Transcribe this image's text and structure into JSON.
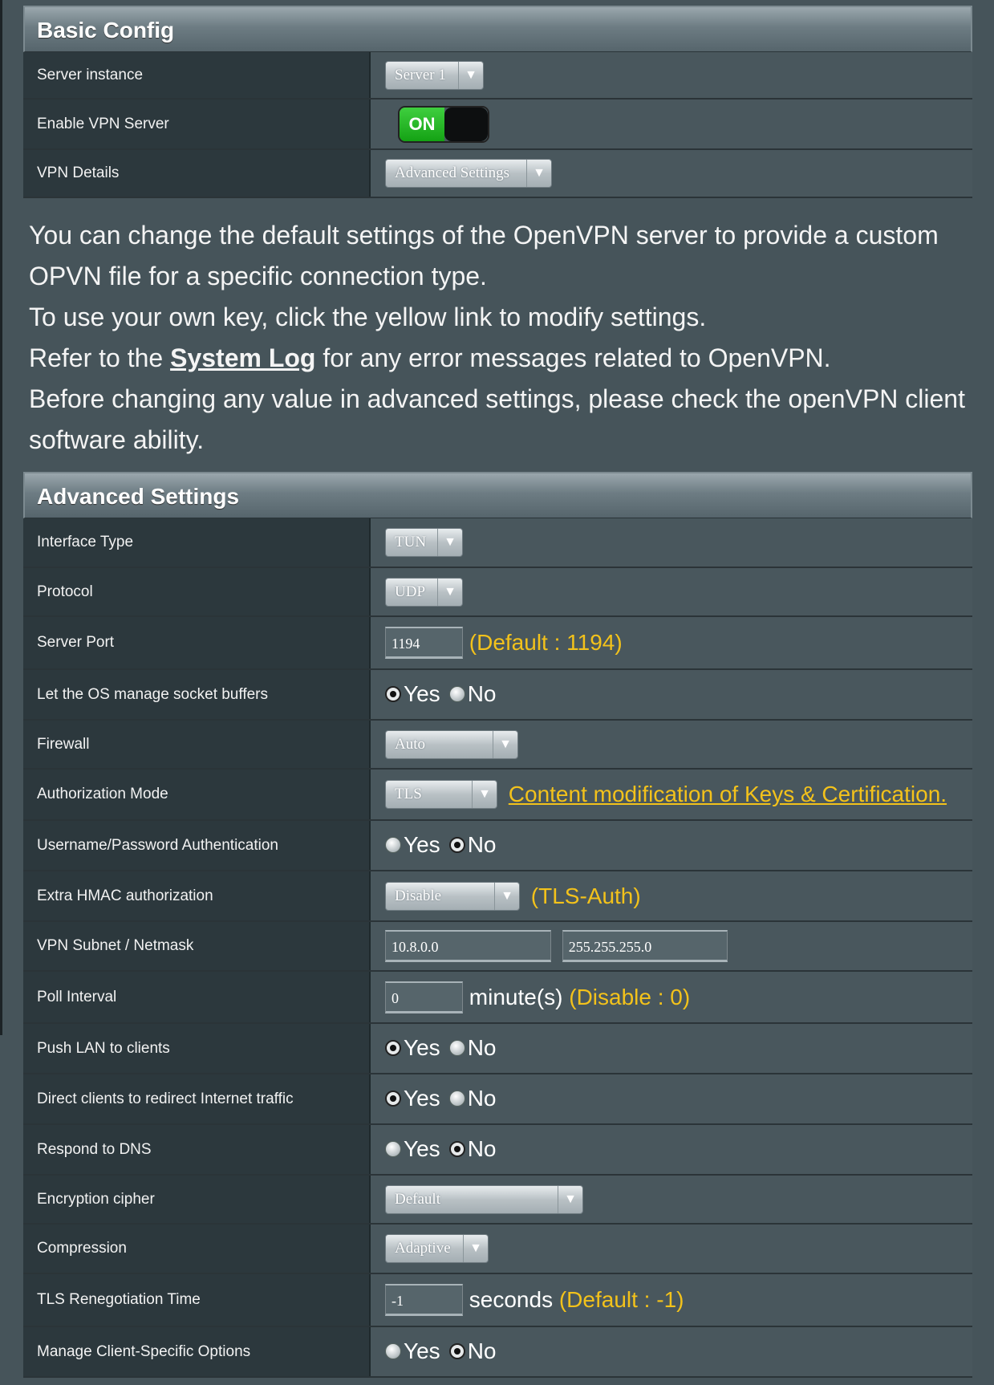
{
  "basic": {
    "title": "Basic Config",
    "server_instance_label": "Server instance",
    "server_instance_value": "Server 1",
    "enable_label": "Enable VPN Server",
    "enable_value": "ON",
    "details_label": "VPN Details",
    "details_value": "Advanced Settings"
  },
  "info": {
    "line1": "You can change the default settings of the OpenVPN server to provide a custom OPVN file for a specific connection type.",
    "line2": "To use your own key, click the yellow link to modify settings.",
    "line3_pre": "Refer to the ",
    "line3_link": "System Log",
    "line3_post": " for any error messages related to OpenVPN.",
    "line4": "Before changing any value in advanced settings, please check the openVPN client software ability."
  },
  "advanced": {
    "title": "Advanced Settings",
    "interface_type": {
      "label": "Interface Type",
      "value": "TUN"
    },
    "protocol": {
      "label": "Protocol",
      "value": "UDP"
    },
    "server_port": {
      "label": "Server Port",
      "value": "1194",
      "note": "(Default : 1194)"
    },
    "socket_buffers": {
      "label": "Let the OS manage socket buffers",
      "yes": "Yes",
      "no": "No",
      "selected": "Yes"
    },
    "firewall": {
      "label": "Firewall",
      "value": "Auto"
    },
    "auth_mode": {
      "label": "Authorization Mode",
      "value": "TLS",
      "link": "Content modification of Keys & Certification."
    },
    "user_pass": {
      "label": "Username/Password Authentication",
      "yes": "Yes",
      "no": "No",
      "selected": "No"
    },
    "hmac": {
      "label": "Extra HMAC authorization",
      "value": "Disable",
      "note": "(TLS-Auth)"
    },
    "subnet": {
      "label": "VPN Subnet / Netmask",
      "subnet": "10.8.0.0",
      "netmask": "255.255.255.0"
    },
    "poll": {
      "label": "Poll Interval",
      "value": "0",
      "unit": "minute(s)",
      "note": "(Disable : 0)"
    },
    "push_lan": {
      "label": "Push LAN to clients",
      "yes": "Yes",
      "no": "No",
      "selected": "Yes"
    },
    "redirect": {
      "label": "Direct clients to redirect Internet traffic",
      "yes": "Yes",
      "no": "No",
      "selected": "Yes"
    },
    "dns": {
      "label": "Respond to DNS",
      "yes": "Yes",
      "no": "No",
      "selected": "No"
    },
    "cipher": {
      "label": "Encryption cipher",
      "value": "Default"
    },
    "compression": {
      "label": "Compression",
      "value": "Adaptive"
    },
    "tls_reneg": {
      "label": "TLS Renegotiation Time",
      "value": "-1",
      "unit": "seconds",
      "note": "(Default : -1)"
    },
    "client_specific": {
      "label": "Manage Client-Specific Options",
      "yes": "Yes",
      "no": "No",
      "selected": "No"
    }
  },
  "colors": {
    "note": "#f3c21b",
    "on": "#1fb51f",
    "label_bg": "#2c383d",
    "value_bg": "#49575d"
  },
  "icons": {
    "dropdown": "triangle-down-icon"
  }
}
